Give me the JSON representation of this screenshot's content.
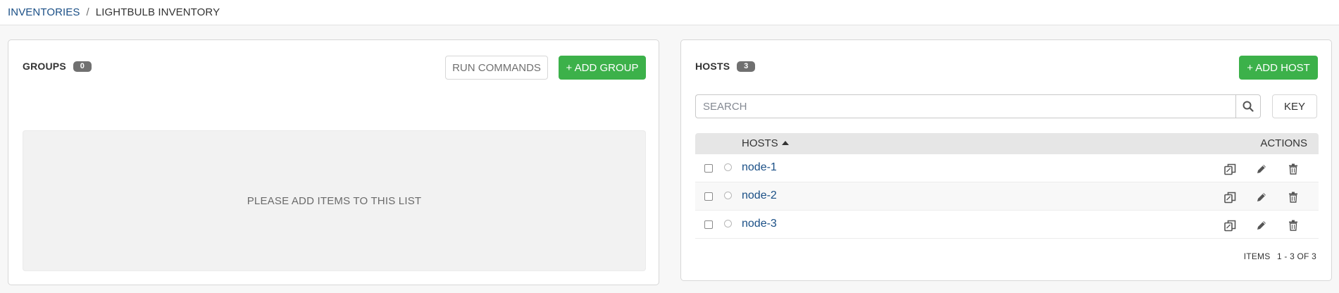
{
  "breadcrumb": {
    "parent": "INVENTORIES",
    "separator": "/",
    "current": "LIGHTBULB INVENTORY"
  },
  "groups_panel": {
    "title": "GROUPS",
    "count": "0",
    "run_commands_label": "RUN COMMANDS",
    "add_group_label": "+ ADD GROUP",
    "empty_message": "PLEASE ADD ITEMS TO THIS LIST"
  },
  "hosts_panel": {
    "title": "HOSTS",
    "count": "3",
    "add_host_label": "+ ADD HOST",
    "search_placeholder": "SEARCH",
    "key_label": "KEY",
    "columns": {
      "hosts": "HOSTS",
      "actions": "ACTIONS"
    },
    "rows": [
      {
        "name": "node-1"
      },
      {
        "name": "node-2"
      },
      {
        "name": "node-3"
      }
    ],
    "pagination": {
      "label": "ITEMS",
      "range": "1 - 3 OF 3"
    }
  },
  "icons": {
    "search": "search-icon",
    "sort": "sort-asc-icon",
    "copy": "copy-icon",
    "edit": "pencil-icon",
    "delete": "trash-icon"
  },
  "colors": {
    "link": "#1a4f86",
    "success": "#3cb14a",
    "badge": "#707070"
  }
}
